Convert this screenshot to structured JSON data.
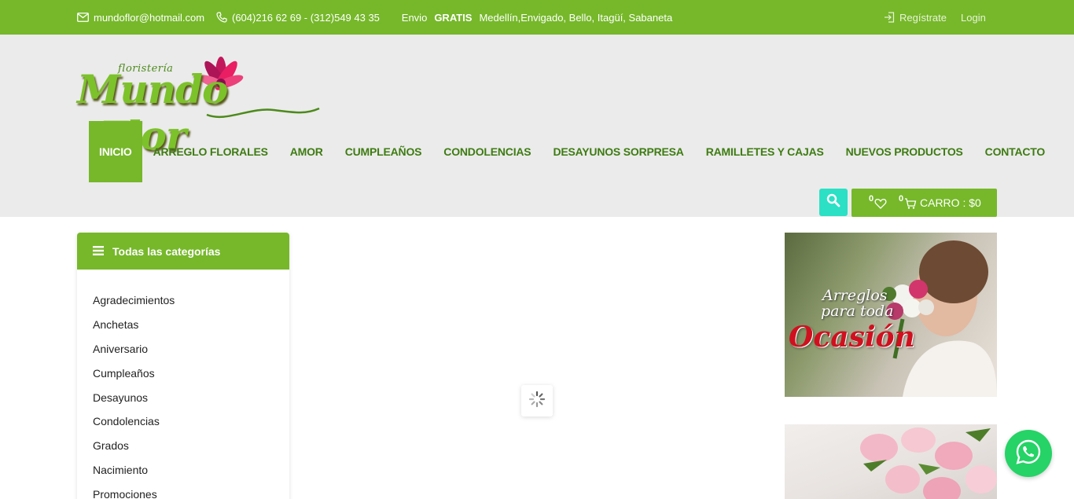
{
  "topbar": {
    "email": "mundoflor@hotmail.com",
    "phone": "(604)216 62 69 - (312)549 43 35",
    "promo_prefix": "Envio",
    "promo_bold": "GRATIS",
    "promo_suffix": "Medellín,Envigado, Bello, Itagüí, Sabaneta",
    "register": "Regístrate",
    "login": "Login"
  },
  "logo": {
    "small": "floristería",
    "word1": "Mundo",
    "word2": "Flor"
  },
  "nav": {
    "items": [
      {
        "label": "INICIO",
        "active": true
      },
      {
        "label": "ARREGLO FLORALES",
        "active": false
      },
      {
        "label": "AMOR",
        "active": false
      },
      {
        "label": "CUMPLEAÑOS",
        "active": false
      },
      {
        "label": "CONDOLENCIAS",
        "active": false
      },
      {
        "label": "DESAYUNOS SORPRESA",
        "active": false
      },
      {
        "label": "RAMILLETES Y CAJAS",
        "active": false
      },
      {
        "label": "NUEVOS PRODUCTOS",
        "active": false
      },
      {
        "label": "CONTACTO",
        "active": false
      }
    ]
  },
  "cart": {
    "wishlist_count": "0",
    "cart_count": "0",
    "label": "CARRO : $0"
  },
  "sidebar": {
    "title": "Todas las categorías",
    "categories": [
      "Agradecimientos",
      "Anchetas",
      "Aniversario",
      "Cumpleaños",
      "Desayunos",
      "Condolencias",
      "Grados",
      "Nacimiento",
      "Promociones"
    ]
  },
  "banners": {
    "banner1": {
      "line1": "Arreglos",
      "line2": "para toda",
      "line3": "Ocasión"
    }
  },
  "colors": {
    "brand_green": "#76b82a",
    "nav_text": "#3e7c12",
    "search_teal": "#2be0c4",
    "whatsapp": "#25d366"
  },
  "icons": {
    "email": "envelope-icon",
    "phone": "phone-icon",
    "register": "login-arrow-icon",
    "search": "search-icon",
    "wishlist": "heart-icon",
    "cart": "cart-icon",
    "menu": "hamburger-icon",
    "loader": "spinner-icon",
    "whatsapp": "whatsapp-icon"
  }
}
